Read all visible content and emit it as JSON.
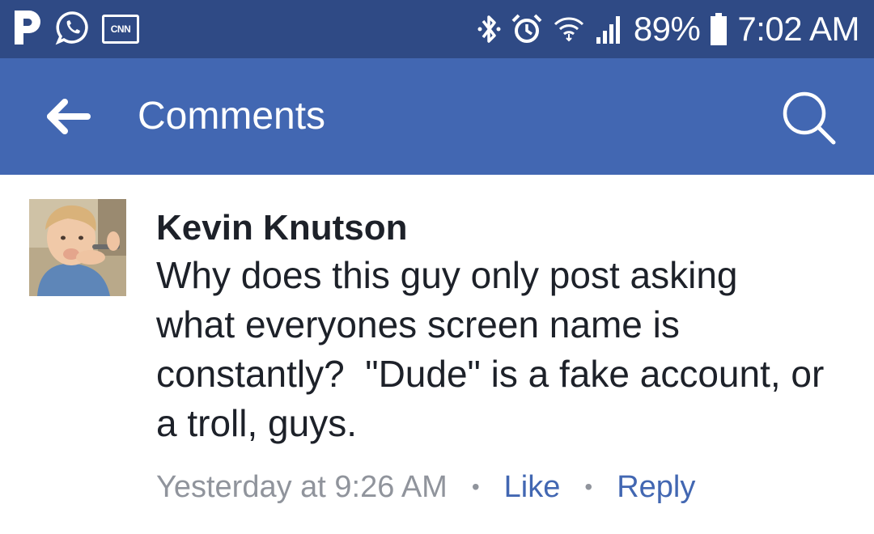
{
  "status_bar": {
    "left_icons": [
      "pandora-icon",
      "whatsapp-icon",
      "cnn-icon"
    ],
    "cnn_label": "CNN",
    "right_icons": [
      "bluetooth-icon",
      "alarm-icon",
      "wifi-icon",
      "signal-icon",
      "battery-icon"
    ],
    "battery_percent": "89%",
    "time": "7:02 AM",
    "background_color": "#2f4a85"
  },
  "app_bar": {
    "title": "Comments",
    "back_icon": "arrow-left-icon",
    "search_icon": "search-icon",
    "background_color": "#4267b2"
  },
  "comment": {
    "author": "Kevin Knutson",
    "text": "Why does this guy only post asking\nwhat everyones screen name is\nconstantly?  \"Dude\" is a fake account, or\na troll, guys.",
    "timestamp": "Yesterday at 9:26 AM",
    "separator": "•",
    "like_label": "Like",
    "reply_label": "Reply",
    "link_color": "#4267b2",
    "meta_color": "#90949c"
  }
}
